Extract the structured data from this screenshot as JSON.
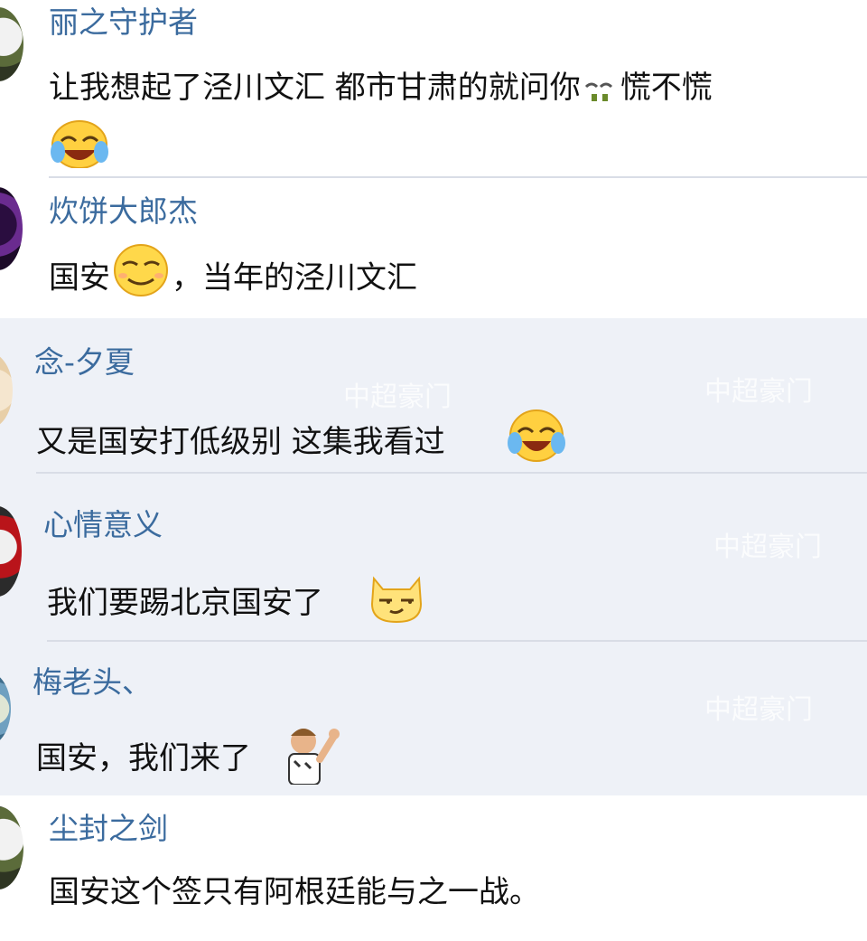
{
  "comments": [
    {
      "author": "丽之守护者",
      "text": "让我想起了泾川文汇 都市甘肃的就问你",
      "text_tail": "慌不慌"
    },
    {
      "author": "炊饼大郎杰",
      "text_a": "国安",
      "text_b": "，当年的泾川文汇"
    },
    {
      "author": "念-夕夏",
      "text": "又是国安打低级别 这集我看过"
    },
    {
      "author": "心情意义",
      "text": "我们要踢北京国安了"
    },
    {
      "author": "梅老头、",
      "text": "国安，我们来了"
    },
    {
      "author": "尘封之剑",
      "text": "国安这个签只有阿根廷能与之一战。"
    }
  ],
  "watermark": {
    "text": "中超豪门"
  },
  "colors": {
    "author": "#3b6b9e",
    "text": "#111111",
    "highlight_bg": "#eef1f7"
  },
  "icons": [
    "laughing-crying-icon",
    "smirk-face-icon",
    "laughing-crying-icon",
    "cat-smug-icon",
    "player-sticker-icon"
  ]
}
